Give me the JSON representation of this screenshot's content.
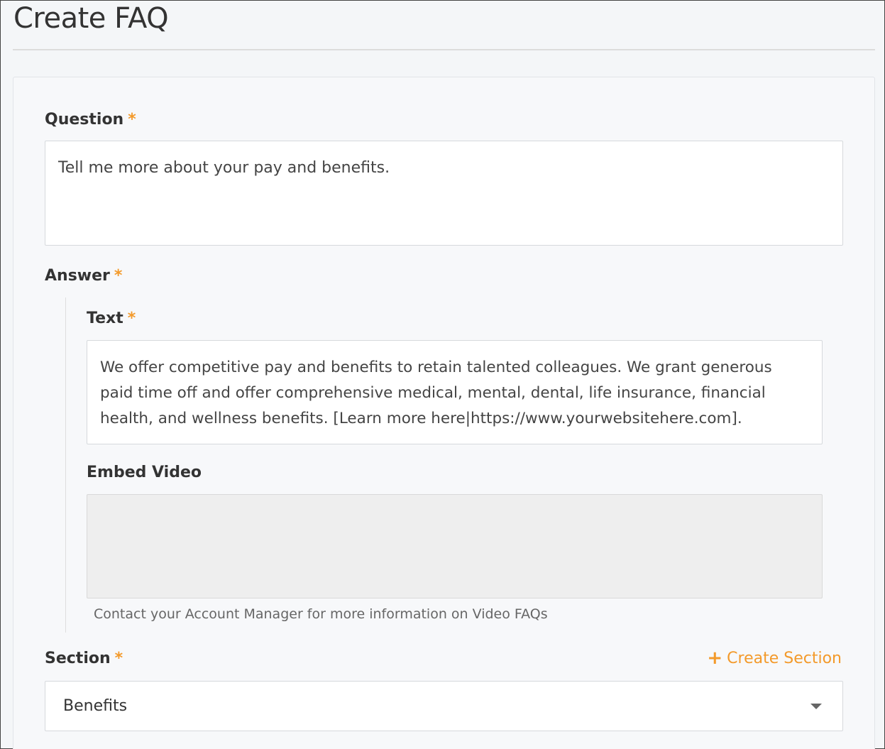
{
  "page": {
    "title": "Create FAQ"
  },
  "form": {
    "question": {
      "label": "Question",
      "required_marker": "*",
      "value": "Tell me more about your pay and benefits."
    },
    "answer": {
      "label": "Answer",
      "required_marker": "*",
      "text": {
        "label": "Text",
        "required_marker": "*",
        "value": "We offer competitive pay and benefits to retain talented colleagues. We grant generous paid time off and offer comprehensive medical, mental, dental, life insurance, financial health, and wellness benefits. [Learn more here|https://www.yourwebsitehere.com]."
      },
      "embed_video": {
        "label": "Embed Video",
        "help_text": "Contact your Account Manager for more information on Video FAQs"
      }
    },
    "section": {
      "label": "Section",
      "required_marker": "*",
      "create_label": "Create Section",
      "selected": "Benefits"
    }
  },
  "colors": {
    "accent": "#f39a2b",
    "background": "#f4f6f8"
  }
}
